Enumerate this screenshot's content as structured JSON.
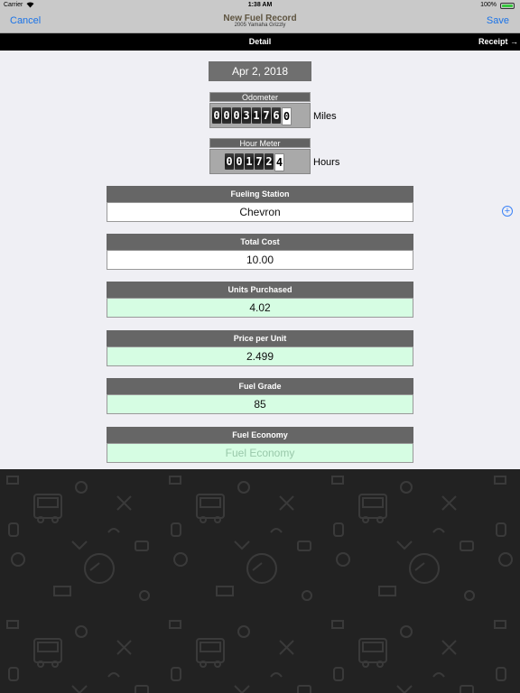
{
  "status": {
    "carrier": "Carrier",
    "time": "1:38 AM",
    "battery": "100%"
  },
  "nav": {
    "cancel": "Cancel",
    "title": "New Fuel Record",
    "subtitle": "2005 Yamaha Grizzly",
    "save": "Save"
  },
  "section": {
    "title": "Detail",
    "receipt": "Receipt →"
  },
  "date": "Apr 2, 2018",
  "odometer": {
    "label": "Odometer",
    "digits": [
      "0",
      "0",
      "0",
      "3",
      "1",
      "7",
      "6",
      "0"
    ],
    "unit": "Miles"
  },
  "hour_meter": {
    "label": "Hour Meter",
    "digits": [
      "0",
      "0",
      "1",
      "7",
      "2",
      "4"
    ],
    "unit": "Hours"
  },
  "fields": {
    "fueling_station": {
      "label": "Fueling Station",
      "value": "Chevron"
    },
    "total_cost": {
      "label": "Total Cost",
      "value": "10.00"
    },
    "units_purchased": {
      "label": "Units Purchased",
      "value": "4.02"
    },
    "price_per_unit": {
      "label": "Price per Unit",
      "value": "2.499"
    },
    "fuel_grade": {
      "label": "Fuel Grade",
      "value": "85"
    },
    "fuel_economy": {
      "label": "Fuel Economy",
      "placeholder": "Fuel Economy"
    }
  },
  "colors": {
    "link": "#1a73e8",
    "header_bg": "#666666",
    "green_field": "#d6fde3"
  },
  "icons": {
    "add": "plus-circle-icon",
    "wifi": "wifi-icon",
    "battery": "battery-icon"
  }
}
